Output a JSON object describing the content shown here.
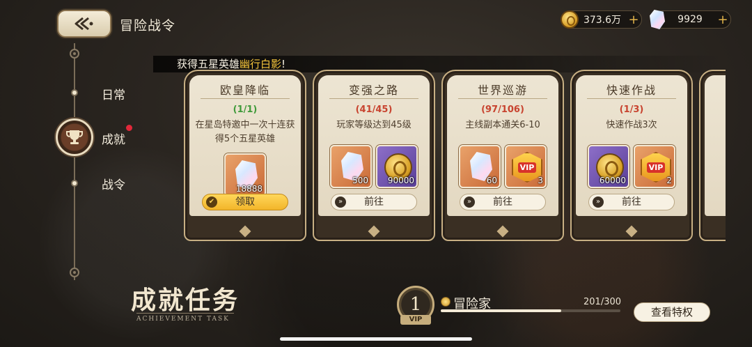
{
  "header": {
    "title": "冒险战令",
    "gold": "373.6万",
    "crystals": "9929",
    "plus": "+"
  },
  "nav": {
    "items": [
      {
        "label": "日常",
        "active": false
      },
      {
        "label": "成就",
        "active": true,
        "badge": true
      },
      {
        "label": "战令",
        "active": false
      }
    ]
  },
  "banner": {
    "text_prefix": "获得五星英雄",
    "text_highlight": "幽行白影",
    "text_suffix": "!"
  },
  "cards": [
    {
      "title": "欧皇降临",
      "progress": "(1/1)",
      "status": "done",
      "desc": "在星岛特邀中一次十连获得5个五星英雄",
      "rewards": [
        {
          "type": "crystal",
          "bg": "orange",
          "qty": "18888"
        }
      ],
      "button": "领取",
      "button_type": "claim"
    },
    {
      "title": "变强之路",
      "progress": "(41/45)",
      "status": "todo",
      "desc": "玩家等级达到45级",
      "rewards": [
        {
          "type": "crystal",
          "bg": "orange",
          "qty": "500"
        },
        {
          "type": "coin",
          "bg": "purple",
          "qty": "90000"
        }
      ],
      "button": "前往",
      "button_type": "go"
    },
    {
      "title": "世界巡游",
      "progress": "(97/106)",
      "status": "todo",
      "desc": "主线副本通关6-10",
      "rewards": [
        {
          "type": "crystal",
          "bg": "orange",
          "qty": "60"
        },
        {
          "type": "vip",
          "bg": "orange",
          "qty": "3"
        }
      ],
      "button": "前往",
      "button_type": "go"
    },
    {
      "title": "快速作战",
      "progress": "(1/3)",
      "status": "todo",
      "desc": "快速作战3次",
      "rewards": [
        {
          "type": "coin",
          "bg": "purple",
          "qty": "60000"
        },
        {
          "type": "vip",
          "bg": "orange",
          "qty": "2"
        }
      ],
      "button": "前往",
      "button_type": "go"
    }
  ],
  "footer": {
    "title": "成就任务",
    "subtitle": "ACHIEVEMENT TASK",
    "vip_level": "1",
    "vip_tag": "VIP",
    "rank_name": "冒险家",
    "progress_text": "201/300",
    "progress_fraction": 0.67,
    "privilege_button": "查看特权"
  },
  "colors": {
    "accent_gold": "#f2b52a",
    "progress_done": "#3f9a3a",
    "progress_todo": "#c8432f",
    "highlight_text": "#f5c53c",
    "notify_red": "#e1283a"
  }
}
